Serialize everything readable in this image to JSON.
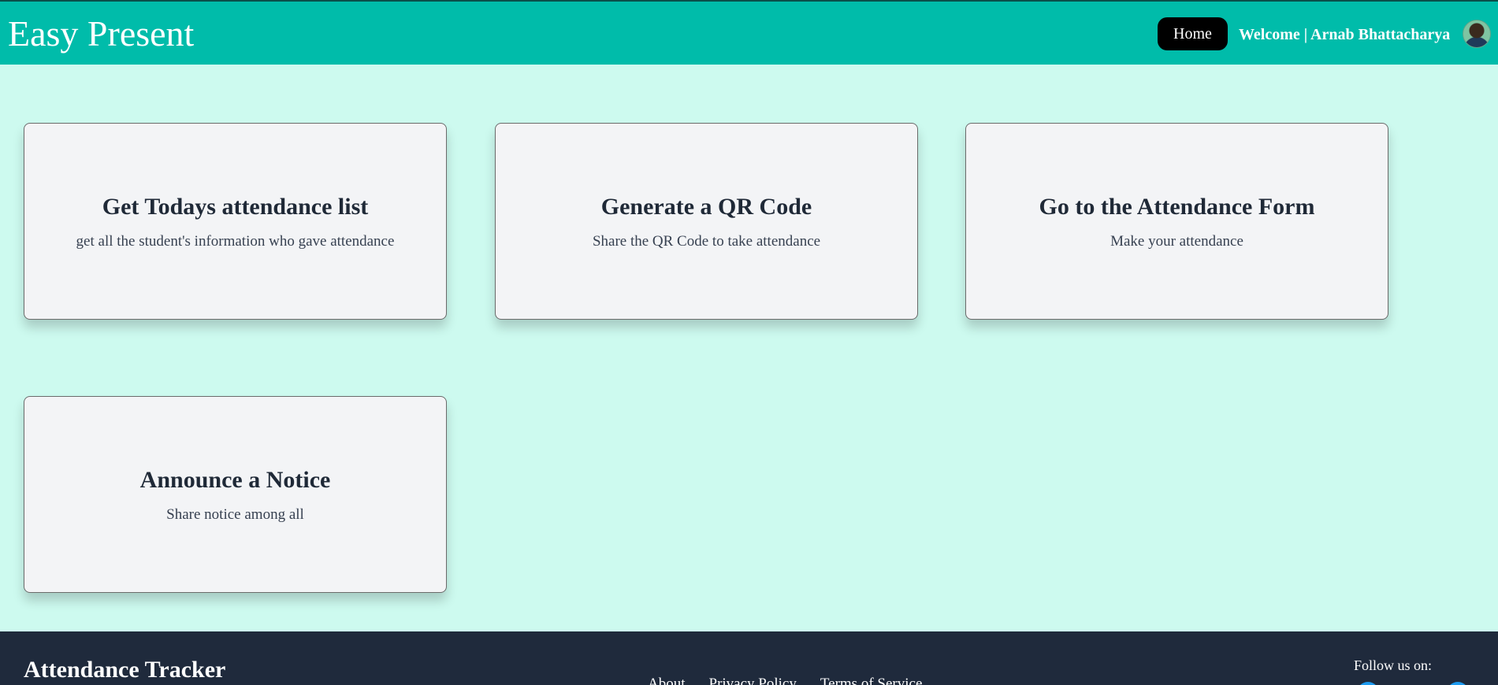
{
  "header": {
    "brand": "Easy Present",
    "home_label": "Home",
    "welcome_text": "Welcome | Arnab Bhattacharya"
  },
  "cards": [
    {
      "title": "Get Todays attendance list",
      "description": "get all the student's information who gave attendance"
    },
    {
      "title": "Generate a QR Code",
      "description": "Share the QR Code to take attendance"
    },
    {
      "title": "Go to the Attendance Form",
      "description": "Make your attendance"
    },
    {
      "title": "Announce a Notice",
      "description": "Share notice among all"
    }
  ],
  "footer": {
    "title": "Attendance Tracker",
    "links": [
      "About",
      "Privacy Policy",
      "Terms of Service"
    ],
    "follow_label": "Follow us on:",
    "social_icons": [
      "social-icon",
      "social-icon"
    ]
  },
  "colors": {
    "navbar": "#00bcaa",
    "page_background": "#cdfaef",
    "card_background": "#f3f4f6",
    "footer_background": "#1f2a3c",
    "home_button": "#000000"
  }
}
